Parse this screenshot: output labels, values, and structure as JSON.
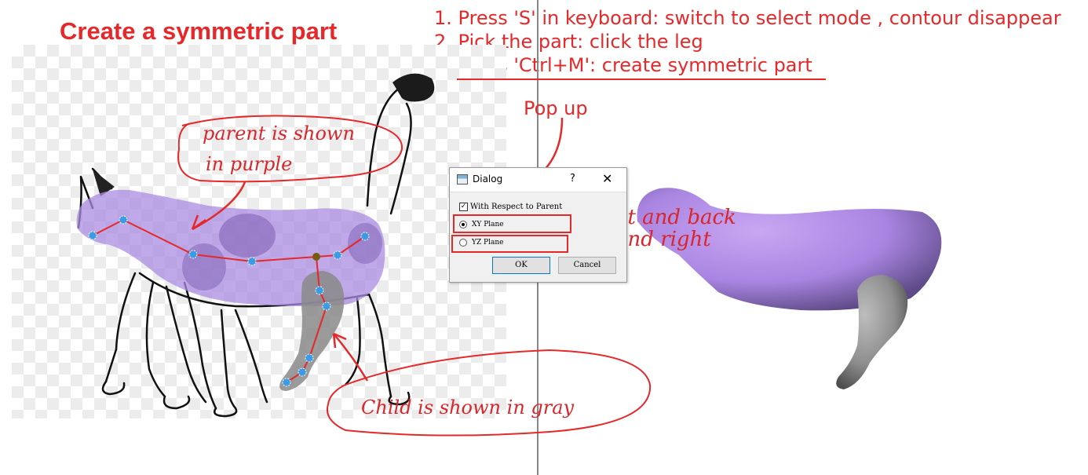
{
  "title": "Create a symmetric part",
  "steps": [
    "1. Press 'S' in keyboard: switch to select mode , contour disappear",
    "2. Pick the part: click the leg",
    "3. Press 'Ctrl+M': create symmetric part"
  ],
  "popup_label": "Pop up",
  "annotations": {
    "parent_line1": "parent is shown",
    "parent_line2": "in purple",
    "child": "Child is shown in gray",
    "front_back": "front and back",
    "left_right": "left and right"
  },
  "dialog": {
    "title": "Dialog",
    "help_label": "?",
    "close_label": "✕",
    "checkbox_label": "With Respect to Parent",
    "checkbox_checked": true,
    "radio_xy_label": "XY Plane",
    "radio_yz_label": "YZ Plane",
    "selected_plane": "XY Plane",
    "ok_label": "OK",
    "cancel_label": "Cancel"
  },
  "colors": {
    "annotation_red": "#e5282a",
    "parent_purple": "#a98ce0",
    "child_gray": "#8f8f8f",
    "joint_blue": "#3b9be6"
  }
}
